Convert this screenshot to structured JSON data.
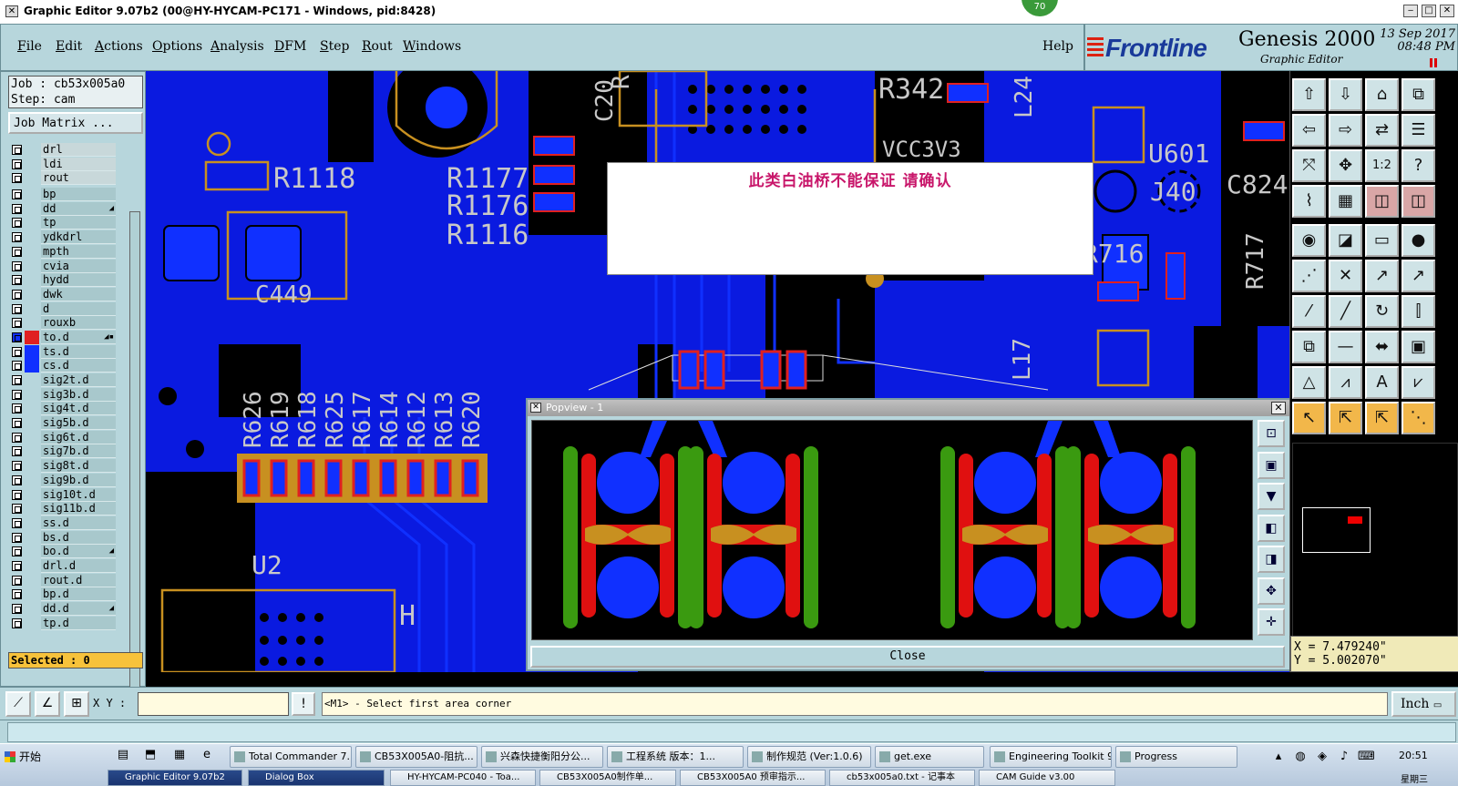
{
  "window": {
    "title": "Graphic Editor 9.07b2 (00@HY-HYCAM-PC171 - Windows, pid:8428)",
    "badge": "70"
  },
  "menu": {
    "items": [
      "File",
      "Edit",
      "Actions",
      "Options",
      "Analysis",
      "DFM",
      "Step",
      "Rout",
      "Windows"
    ],
    "help": "Help"
  },
  "brand": {
    "logo": "Frontline",
    "product": "Genesis 2000",
    "subtitle": "Graphic Editor",
    "date": "13 Sep 2017",
    "time": "08:48 PM"
  },
  "job": {
    "job_line": "Job : cb53x005a0",
    "step_line": "Step: cam",
    "matrix_button": "Job Matrix ..."
  },
  "layers": [
    {
      "name": "drl",
      "group": 1
    },
    {
      "name": "ldi",
      "group": 1
    },
    {
      "name": "rout",
      "group": 1
    },
    {
      "name": "bp",
      "group": 2
    },
    {
      "name": "dd",
      "group": 2,
      "mark": "arrow"
    },
    {
      "name": "tp",
      "group": 2
    },
    {
      "name": "ydkdrl",
      "group": 2
    },
    {
      "name": "mpth",
      "group": 2
    },
    {
      "name": "cvia",
      "group": 2
    },
    {
      "name": "hydd",
      "group": 2
    },
    {
      "name": "dwk",
      "group": 2
    },
    {
      "name": "d",
      "group": 2
    },
    {
      "name": "rouxb",
      "group": 2
    },
    {
      "name": "to.d",
      "group": 2,
      "swatch": "#e02020",
      "mark": "arrow-dot",
      "active": true
    },
    {
      "name": "ts.d",
      "group": 2,
      "swatch": "#1030ff"
    },
    {
      "name": "cs.d",
      "group": 2,
      "swatch": "#1030ff"
    },
    {
      "name": "sig2t.d",
      "group": 2
    },
    {
      "name": "sig3b.d",
      "group": 2
    },
    {
      "name": "sig4t.d",
      "group": 2
    },
    {
      "name": "sig5b.d",
      "group": 2
    },
    {
      "name": "sig6t.d",
      "group": 2
    },
    {
      "name": "sig7b.d",
      "group": 2
    },
    {
      "name": "sig8t.d",
      "group": 2
    },
    {
      "name": "sig9b.d",
      "group": 2
    },
    {
      "name": "sig10t.d",
      "group": 2
    },
    {
      "name": "sig11b.d",
      "group": 2
    },
    {
      "name": "ss.d",
      "group": 2
    },
    {
      "name": "bs.d",
      "group": 2
    },
    {
      "name": "bo.d",
      "group": 2,
      "mark": "arrow"
    },
    {
      "name": "drl.d",
      "group": 2
    },
    {
      "name": "rout.d",
      "group": 2
    },
    {
      "name": "bp.d",
      "group": 2
    },
    {
      "name": "dd.d",
      "group": 2,
      "mark": "arrow"
    },
    {
      "name": "tp.d",
      "group": 2
    }
  ],
  "selected": "Selected : 0",
  "canvas": {
    "refdes": [
      "R1118",
      "R1177",
      "R1176",
      "R1116",
      "C449",
      "R342",
      "L24",
      "U601",
      "J40",
      "C824",
      "R716",
      "R717",
      "L17",
      "R626",
      "R619",
      "R618",
      "R625",
      "R617",
      "R614",
      "R612",
      "R613",
      "R620",
      "U2",
      "H",
      "C20",
      "VCC3V3",
      "R"
    ],
    "colors": {
      "copper": "#0a1ae0",
      "silk": "#c89020",
      "board": "#000000",
      "pad": "#d01010",
      "text": "#c8c8c8"
    }
  },
  "message": {
    "text": "此类白油桥不能保证  请确认"
  },
  "popview": {
    "title": "Popview - 1",
    "close_label": "Close",
    "tools": [
      "zoom-fit",
      "zoom-in",
      "zoom-out",
      "pan-left",
      "pan-right",
      "fit-all",
      "pan"
    ]
  },
  "coords": {
    "x": "X =  7.479240\"",
    "y": "Y =  5.002070\""
  },
  "command": {
    "xy_label": "X Y :",
    "xy_value": "",
    "prompt": "<M1> - Select first area corner",
    "units": "Inch"
  },
  "taskbar": {
    "start": "开始",
    "tasks": [
      "Total Commander 7....",
      "CB53X005A0-阻抗...",
      "兴森快捷衡阳分公...",
      "工程系统  版本：1...",
      "制作规范 (Ver:1.0.6)",
      "get.exe",
      "Engineering Toolkit 9...",
      "Progress"
    ],
    "tasks_row2": [
      "Graphic Editor 9.07b2",
      "Dialog Box",
      "HY-HYCAM-PC040 - Toa...",
      "CB53X005A0制作单...",
      "CB53X005A0 预审指示...",
      "cb53x005a0.txt - 记事本",
      "CAM Guide v3.00"
    ],
    "clock": "20:51",
    "day": "星期三"
  }
}
